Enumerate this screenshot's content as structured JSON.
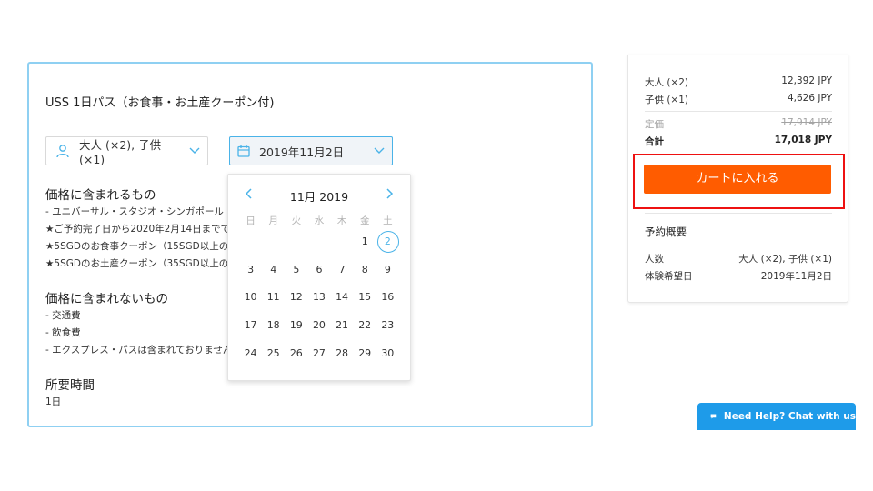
{
  "product": {
    "title": "USS 1日パス（お食事・お土産クーポン付)",
    "pax_value": "大人 (×2), 子供 (×1)",
    "date_value": "2019年11月2日",
    "included": {
      "heading": "価格に含まれるもの",
      "lines": [
        "- ユニバーサル・スタジオ・シンガポール (U",
        "★ご予約完了日から2020年2月14日までであ",
        "★5SGDのお食事クーポン（15SGD以上のお",
        "★5SGDのお土産クーポン（35SGD以上のお"
      ]
    },
    "excluded": {
      "heading": "価格に含まれないもの",
      "lines": [
        "- 交通費",
        "- 飲食費",
        "- エクスプレス・パスは含まれておりません。"
      ]
    },
    "duration": {
      "heading": "所要時間",
      "value": "1日"
    }
  },
  "calendar": {
    "month_label": "11月 2019",
    "weekdays": [
      "日",
      "月",
      "火",
      "水",
      "木",
      "金",
      "土"
    ],
    "weeks": [
      [
        "",
        "",
        "",
        "",
        "",
        "1",
        "2"
      ],
      [
        "3",
        "4",
        "5",
        "6",
        "7",
        "8",
        "9"
      ],
      [
        "10",
        "11",
        "12",
        "13",
        "14",
        "15",
        "16"
      ],
      [
        "17",
        "18",
        "19",
        "20",
        "21",
        "22",
        "23"
      ],
      [
        "24",
        "25",
        "26",
        "27",
        "28",
        "29",
        "30"
      ]
    ],
    "selected": "2"
  },
  "summary": {
    "rows": [
      {
        "label": "大人 (×2)",
        "value": "12,392 JPY"
      },
      {
        "label": "子供 (×1)",
        "value": "4,626 JPY"
      }
    ],
    "list_price_label": "定価",
    "list_price_value": "17,914 JPY",
    "total_label": "合計",
    "total_value": "17,018 JPY",
    "cart_button": "カートに入れる",
    "overview_heading": "予約概要",
    "overview": [
      {
        "label": "人数",
        "value": "大人 (×2), 子供 (×1)"
      },
      {
        "label": "体験希望日",
        "value": "2019年11月2日"
      }
    ]
  },
  "chat": {
    "label": "Need Help? Chat with us"
  },
  "colors": {
    "accent_blue": "#4ab3e8",
    "card_border": "#8fd0f2",
    "cart_orange": "#ff5c00",
    "highlight_red": "#ee1111",
    "chat_blue": "#1e9be9"
  },
  "icons": [
    "person-icon",
    "chevron-down-icon",
    "calendar-icon",
    "chevron-left-icon",
    "chevron-right-icon",
    "chat-bubble-icon"
  ]
}
